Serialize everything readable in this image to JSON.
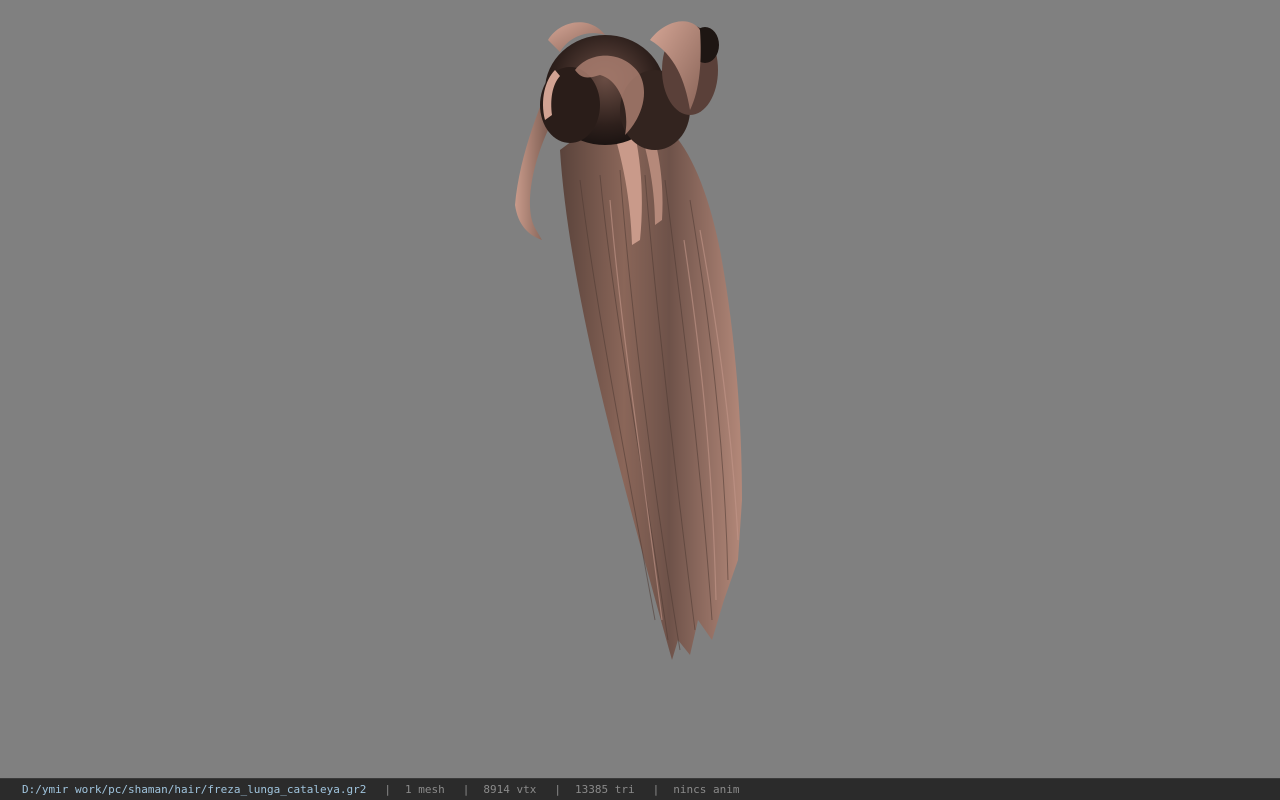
{
  "viewer": {
    "background_color": "#808080",
    "model": {
      "description_icon": "hair-model",
      "colors": {
        "light": "#c8998a",
        "mid": "#8e6a5e",
        "dark": "#3b2a25",
        "shadow": "#241a17"
      }
    }
  },
  "statusbar": {
    "file_path": "D:/ymir work/pc/shaman/hair/freza_lunga_cataleya.gr2",
    "separator": "|",
    "mesh_count": "1 mesh",
    "vertex_count": "8914 vtx",
    "triangle_count": "13385 tri",
    "anim_status": "nincs anim",
    "path_color": "#9fc3dc",
    "text_color": "#8a8a8a"
  }
}
